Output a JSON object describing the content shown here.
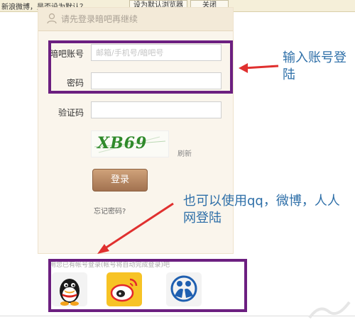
{
  "notification_bar": {
    "message": "新浪微博，是否设为默认？",
    "set_default_label": "设为默认浏览器",
    "close_label": "关闭"
  },
  "login_panel": {
    "header_prompt": "请先登录暗吧再继续",
    "account_label": "暗吧账号",
    "account_placeholder": "邮箱/手机号/暗吧号",
    "password_label": "密码",
    "captcha_label": "验证码",
    "captcha_image_text": "XB69",
    "refresh_label": "刷新",
    "login_button_label": "登录",
    "forgot_password_label": "忘记密码?"
  },
  "social_login": {
    "hint": "用您已有帐号登录(帐号将自动完成登录)吧",
    "providers": [
      "qq-icon",
      "weibo-icon",
      "renren-icon"
    ]
  },
  "annotations": {
    "account_note": "输入账号登陆",
    "social_note": "也可以使用qq，微博，人人网登陆"
  },
  "colors": {
    "highlight": "#6c1f80",
    "annotation": "#2e6fa8",
    "arrow": "#e0302f",
    "login_button": "#b58562"
  }
}
